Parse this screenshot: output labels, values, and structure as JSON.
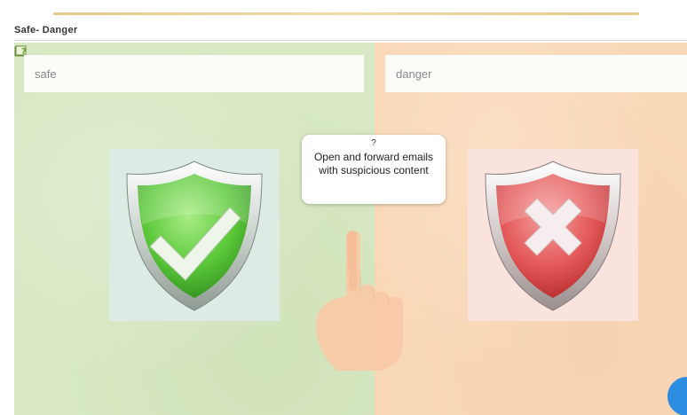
{
  "page": {
    "activity_title": "Safe- Danger"
  },
  "zones": {
    "safe": {
      "label": "safe",
      "icon": "check-shield-icon",
      "color": "#d7e8c2"
    },
    "danger": {
      "label": "danger",
      "icon": "x-shield-icon",
      "color": "#f9d8b7"
    }
  },
  "term_card": {
    "question_mark": "?",
    "text": "Open and forward emails with suspicious content"
  },
  "icons": {
    "help": "help-book-icon",
    "pointer": "hand-pointer-icon",
    "corner": "blue-circle-button"
  }
}
